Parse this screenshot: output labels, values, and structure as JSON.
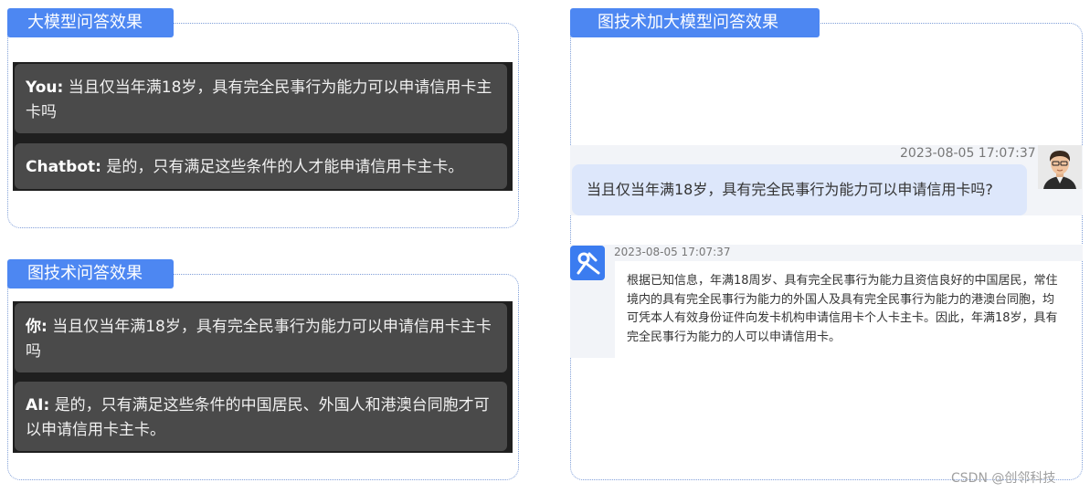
{
  "left_top": {
    "tag": "大模型问答效果",
    "user_label": "You:",
    "user_text": "当且仅当年满18岁，具有完全民事行为能力可以申请信用卡主卡吗",
    "bot_label": "Chatbot:",
    "bot_text": "是的，只有满足这些条件的人才能申请信用卡主卡。"
  },
  "left_bottom": {
    "tag": "图技术问答效果",
    "user_label": "你:",
    "user_text": "当且仅当年满18岁，具有完全民事行为能力可以申请信用卡主卡吗",
    "bot_label": "AI:",
    "bot_text": "是的，只有满足这些条件的中国居民、外国人和港澳台同胞才可以申请信用卡主卡。"
  },
  "right": {
    "tag": "图技术加大模型问答效果",
    "user_time": "2023-08-05 17:07:37",
    "user_text": "当且仅当年满18岁，具有完全民事行为能力可以申请信用卡吗?",
    "bot_time": "2023-08-05 17:07:37",
    "bot_text": "根据已知信息，年满18周岁、具有完全民事行为能力且资信良好的中国居民，常住境内的具有完全民事行为能力的外国人及具有完全民事行为能力的港澳台同胞，均可凭本人有效身份证件向发卡机构申请信用卡个人卡主卡。因此，年满18岁，具有完全民事行为能力的人可以申请信用卡。"
  },
  "watermark": "CSDN @创邻科技",
  "colors": {
    "accent": "#4d87f2",
    "dark_bg": "#1f1f1f",
    "bubble_bg": "#4a4a4a",
    "user_bubble": "#dde7fb"
  }
}
